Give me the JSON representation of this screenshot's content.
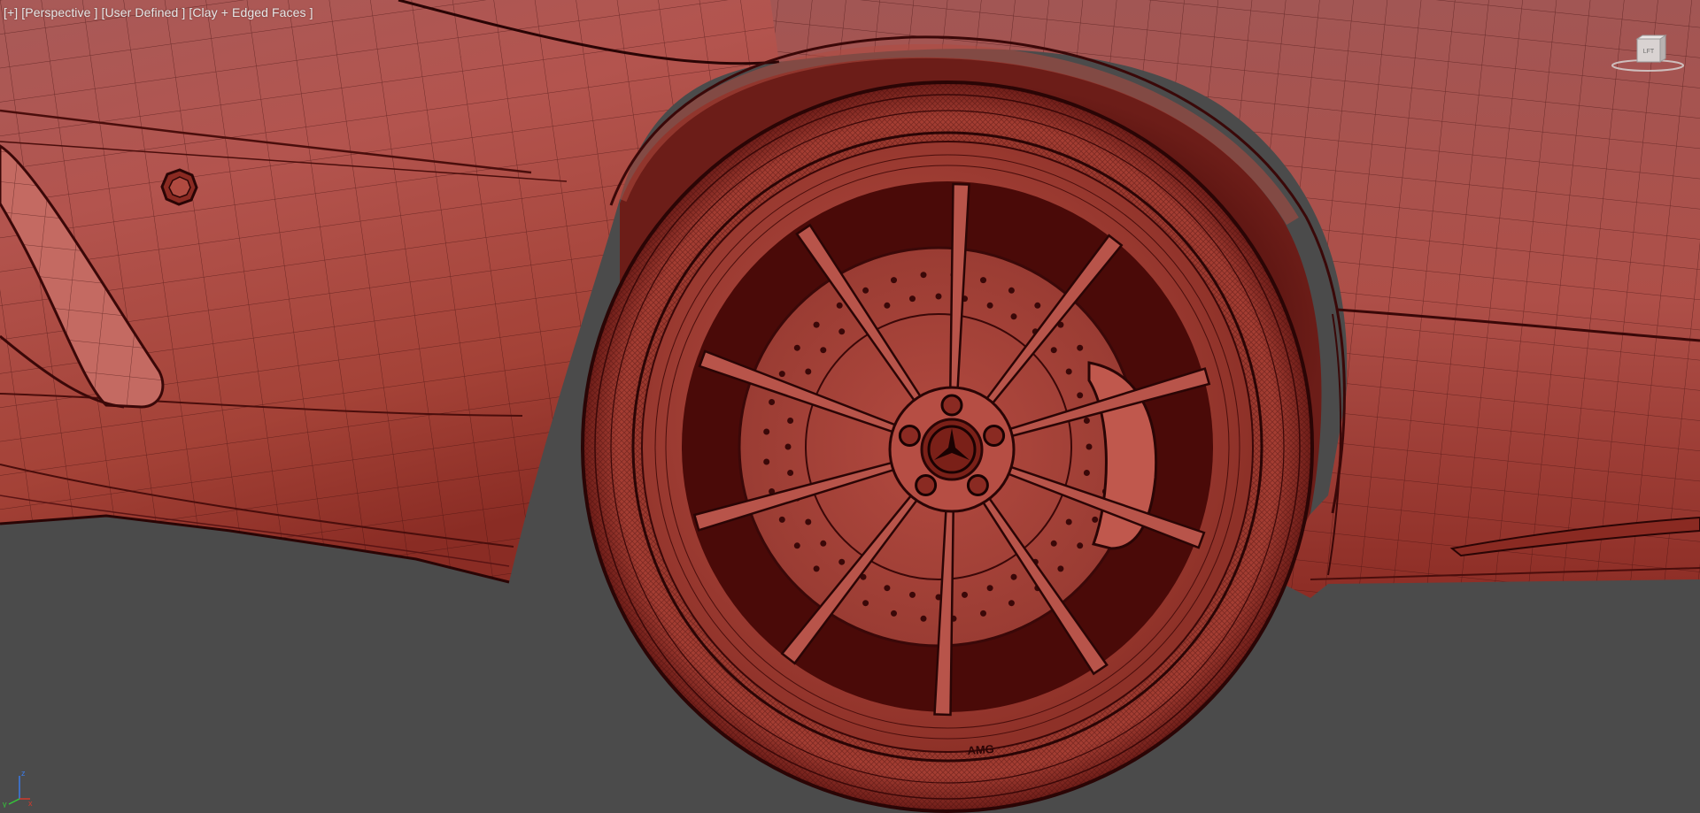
{
  "viewport": {
    "labels": [
      {
        "id": "plus",
        "text": "[+]"
      },
      {
        "id": "view",
        "text": "[Perspective ]"
      },
      {
        "id": "camera",
        "text": "[User Defined ]"
      },
      {
        "id": "shading",
        "text": "[Clay + Edged Faces ]"
      }
    ],
    "viewcube_face": "LFT",
    "axis": {
      "x": "x",
      "y": "y",
      "z": "z"
    }
  },
  "wheel": {
    "hub_emblem": "three-pointed-star-icon",
    "rim_badge": "AMG"
  },
  "colors": {
    "background": "#4b4b4b",
    "clay": "#b6544c",
    "clay_dark": "#5a1414",
    "wire": "#3a0a0a",
    "label_text": "#e6e6e6"
  }
}
